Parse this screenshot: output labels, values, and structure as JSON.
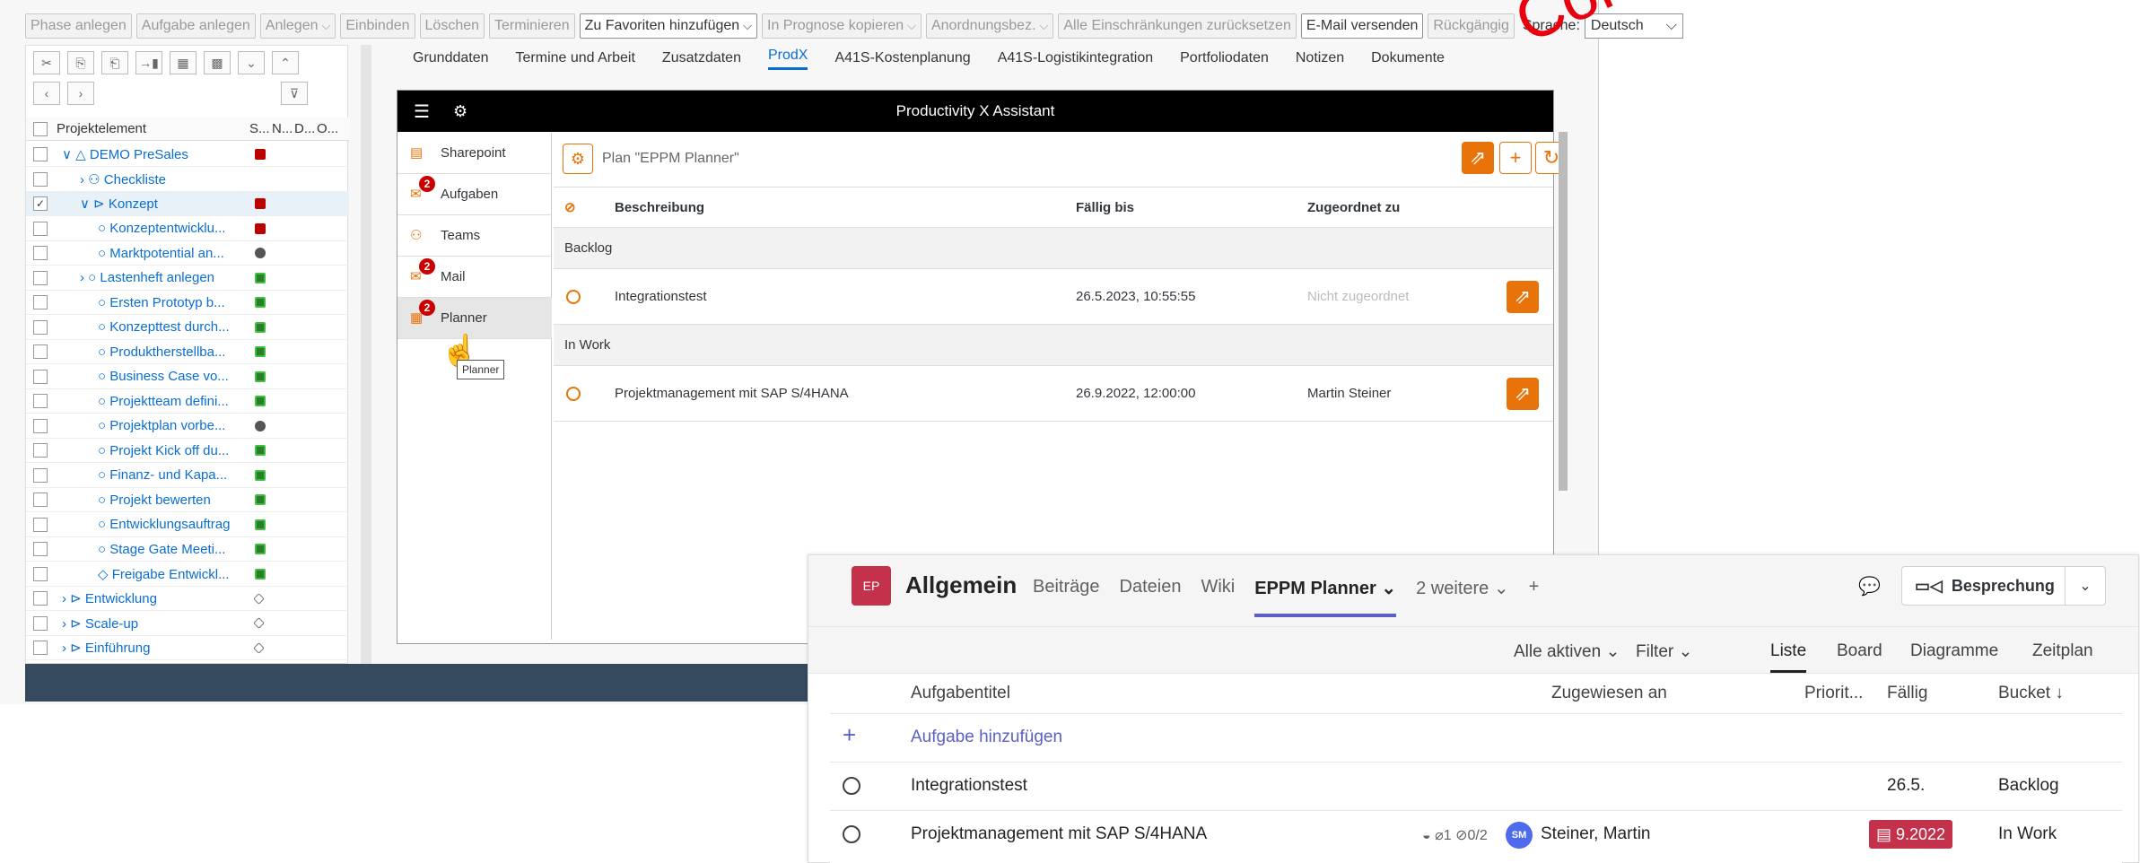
{
  "toolbar": {
    "items": [
      "Phase anlegen",
      "Aufgabe anlegen",
      "Anlegen",
      "Einbinden",
      "Löschen",
      "Terminieren",
      "Zu Favoriten hinzufügen",
      "In Prognose kopieren",
      "Anordnungsbez.",
      "Alle Einschränkungen zurücksetzen",
      "E-Mail versenden",
      "Rückgängig"
    ],
    "sprache_label": "Sprache:",
    "sprache_value": "Deutsch"
  },
  "watermark": "Consult",
  "tree": {
    "headers": [
      "Projektelement",
      "S...",
      "N...",
      "D...",
      "O..."
    ],
    "rows": [
      {
        "label": "DEMO PreSales",
        "indent": 1,
        "prefix": "∨ △",
        "status": "red",
        "checked": false
      },
      {
        "label": "Checkliste",
        "indent": 2,
        "prefix": "› ⚇",
        "status": "none",
        "checked": false
      },
      {
        "label": "Konzept",
        "indent": 2,
        "prefix": "∨ ⊳",
        "status": "red",
        "checked": true
      },
      {
        "label": "Konzeptentwicklu...",
        "indent": 3,
        "prefix": "○",
        "status": "red",
        "checked": false
      },
      {
        "label": "Marktpotential an...",
        "indent": 3,
        "prefix": "○",
        "status": "gray",
        "checked": false
      },
      {
        "label": "Lastenheft anlegen",
        "indent": 2,
        "prefix": "› ○",
        "status": "green",
        "checked": false
      },
      {
        "label": "Ersten Prototyp b...",
        "indent": 3,
        "prefix": "○",
        "status": "green",
        "checked": false
      },
      {
        "label": "Konzepttest durch...",
        "indent": 3,
        "prefix": "○",
        "status": "green",
        "checked": false
      },
      {
        "label": "Produktherstellba...",
        "indent": 3,
        "prefix": "○",
        "status": "green",
        "checked": false
      },
      {
        "label": "Business Case vo...",
        "indent": 3,
        "prefix": "○",
        "status": "green",
        "checked": false
      },
      {
        "label": "Projektteam defini...",
        "indent": 3,
        "prefix": "○",
        "status": "green",
        "checked": false
      },
      {
        "label": "Projektplan vorbe...",
        "indent": 3,
        "prefix": "○",
        "status": "gray",
        "checked": false
      },
      {
        "label": "Projekt Kick off du...",
        "indent": 3,
        "prefix": "○",
        "status": "green",
        "checked": false
      },
      {
        "label": "Finanz- und Kapa...",
        "indent": 3,
        "prefix": "○",
        "status": "green",
        "checked": false
      },
      {
        "label": "Projekt bewerten",
        "indent": 3,
        "prefix": "○",
        "status": "green",
        "checked": false
      },
      {
        "label": "Entwicklungsauftrag",
        "indent": 3,
        "prefix": "○",
        "status": "green",
        "checked": false
      },
      {
        "label": "Stage Gate Meeti...",
        "indent": 3,
        "prefix": "○",
        "status": "green",
        "checked": false
      },
      {
        "label": "Freigabe Entwickl...",
        "indent": 3,
        "prefix": "◇",
        "status": "green",
        "checked": false
      },
      {
        "label": "Entwicklung",
        "indent": 1,
        "prefix": "› ⊳",
        "status": "diamond",
        "checked": false
      },
      {
        "label": "Scale-up",
        "indent": 1,
        "prefix": "› ⊳",
        "status": "diamond",
        "checked": false
      },
      {
        "label": "Einführung",
        "indent": 1,
        "prefix": "› ⊳",
        "status": "diamond",
        "checked": false
      }
    ]
  },
  "tabs": [
    "Grunddaten",
    "Termine und Arbeit",
    "Zusatzdaten",
    "ProdX",
    "A41S-Kostenplanung",
    "A41S-Logistikintegration",
    "Portfoliodaten",
    "Notizen",
    "Dokumente"
  ],
  "active_tab": "ProdX",
  "prodx": {
    "title": "Productivity X Assistant",
    "nav": [
      {
        "label": "Sharepoint",
        "badge": ""
      },
      {
        "label": "Aufgaben",
        "badge": "2"
      },
      {
        "label": "Teams",
        "badge": ""
      },
      {
        "label": "Mail",
        "badge": "2"
      },
      {
        "label": "Planner",
        "badge": "2"
      }
    ],
    "tooltip": "Planner",
    "plan_title": "Plan \"EPPM Planner\"",
    "columns": [
      "Beschreibung",
      "Fällig bis",
      "Zugeordnet zu"
    ],
    "groups": [
      {
        "name": "Backlog",
        "task": "Integrationstest",
        "due": "26.5.2023, 10:55:55",
        "assigned": "Nicht zugeordnet"
      },
      {
        "name": "In Work",
        "task": "Projektmanagement mit SAP S/4HANA",
        "due": "26.9.2022, 12:00:00",
        "assigned": "Martin Steiner"
      }
    ]
  },
  "teams": {
    "team_badge": "EP",
    "channel": "Allgemein",
    "tabs": [
      "Beiträge",
      "Dateien",
      "Wiki",
      "EPPM Planner ⌄",
      "2 weitere ⌄",
      "+"
    ],
    "meeting": "Besprechung",
    "filters": {
      "active": "Alle aktiven ⌄",
      "filter": "Filter ⌄",
      "views": [
        "Liste",
        "Board",
        "Diagramme",
        "Zeitplan"
      ]
    },
    "columns": [
      "Aufgabentitel",
      "Zugewiesen an",
      "Priorit...",
      "Fällig",
      "Bucket ↓"
    ],
    "add": "Aufgabe hinzufügen",
    "rows": [
      {
        "title": "Integrationstest",
        "assigned": "",
        "due": "26.5.",
        "bucket": "Backlog"
      },
      {
        "title": "Projektmanagement mit SAP S/4HANA",
        "meta": "◒ ⌀1 ⊘0/2",
        "initials": "SM",
        "assigned": "Steiner, Martin",
        "due": "9.2022",
        "bucket": "In Work"
      }
    ]
  }
}
